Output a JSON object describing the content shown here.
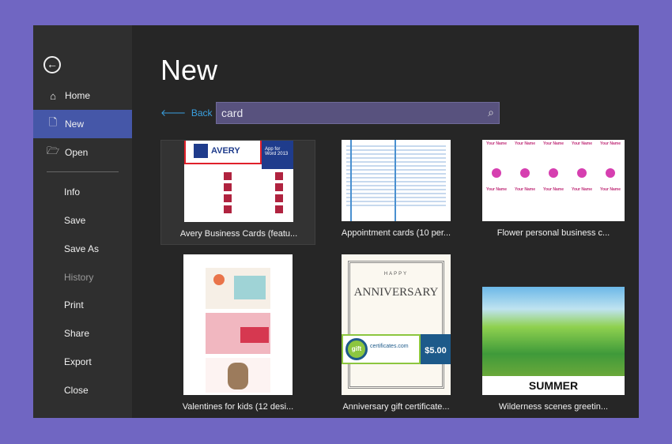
{
  "sidebar": {
    "back_icon": "circle-arrow-left-icon",
    "items": [
      {
        "label": "Home",
        "icon": "home-icon"
      },
      {
        "label": "New",
        "icon": "document-icon",
        "selected": true
      },
      {
        "label": "Open",
        "icon": "folder-open-icon"
      },
      {
        "label": "Info"
      },
      {
        "label": "Save"
      },
      {
        "label": "Save As"
      },
      {
        "label": "History",
        "disabled": true
      },
      {
        "label": "Print"
      },
      {
        "label": "Share"
      },
      {
        "label": "Export"
      },
      {
        "label": "Close"
      }
    ]
  },
  "main": {
    "title": "New",
    "back_label": "Back",
    "search": {
      "value": "card",
      "icon": "search-icon"
    },
    "templates": [
      {
        "caption": "Avery Business Cards (featu...",
        "thumb_text": [
          "AVERY",
          "App for Word 2013"
        ]
      },
      {
        "caption": "Appointment cards (10 per..."
      },
      {
        "caption": "Flower personal business c...",
        "thumb_text": [
          "Your Name"
        ]
      },
      {
        "caption": "Valentines for kids (12 desi..."
      },
      {
        "caption": "Anniversary gift certificate...",
        "thumb_text": [
          "HAPPY",
          "ANNIVERSARY",
          "gift",
          "certificates.com",
          "$5.00"
        ]
      },
      {
        "caption": "Wilderness scenes  greetin...",
        "thumb_text": [
          "SUMMER"
        ]
      }
    ]
  },
  "colors": {
    "accent": "#4557a8",
    "background": "#7066c2",
    "link": "#3aa0e0"
  }
}
